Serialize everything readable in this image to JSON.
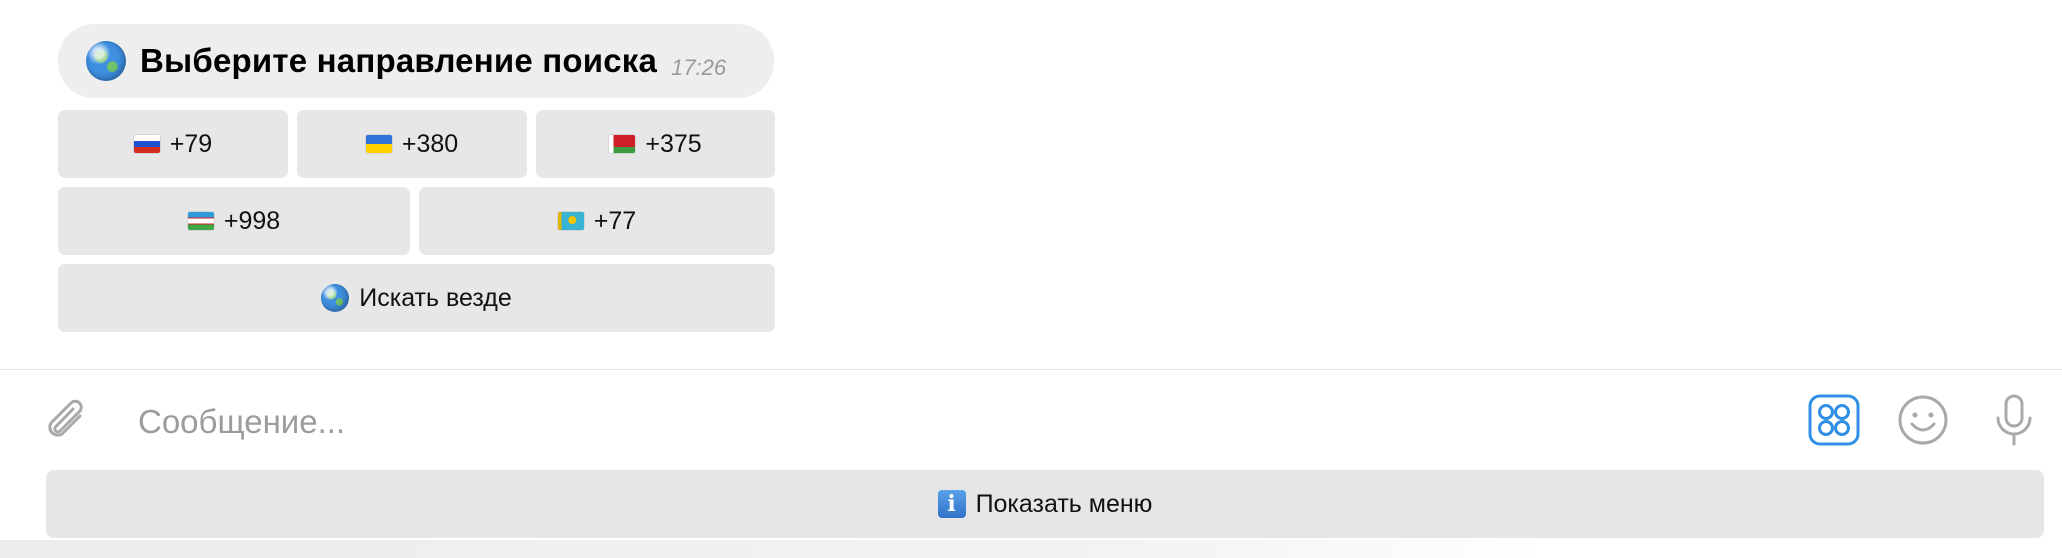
{
  "message": {
    "title": "Выберите направление поиска",
    "time": "17:26",
    "icon": "globe-icon"
  },
  "keyboard": {
    "row1": [
      {
        "flag": "russia-flag-icon",
        "label": "+79"
      },
      {
        "flag": "ukraine-flag-icon",
        "label": "+380"
      },
      {
        "flag": "belarus-flag-icon",
        "label": "+375"
      }
    ],
    "row2": [
      {
        "flag": "uzbekistan-flag-icon",
        "label": "+998"
      },
      {
        "flag": "kazakhstan-flag-icon",
        "label": "+77"
      }
    ],
    "row3": [
      {
        "icon": "globe-icon",
        "label": "Искать везде"
      }
    ]
  },
  "composer": {
    "placeholder": "Сообщение...",
    "attach_icon": "paperclip-icon",
    "commands_icon": "commands-grid-icon",
    "emoji_icon": "smiley-icon",
    "voice_icon": "microphone-icon",
    "accent_color": "#2f8fe6"
  },
  "menu_button": {
    "icon": "info-icon",
    "label": "Показать меню"
  }
}
